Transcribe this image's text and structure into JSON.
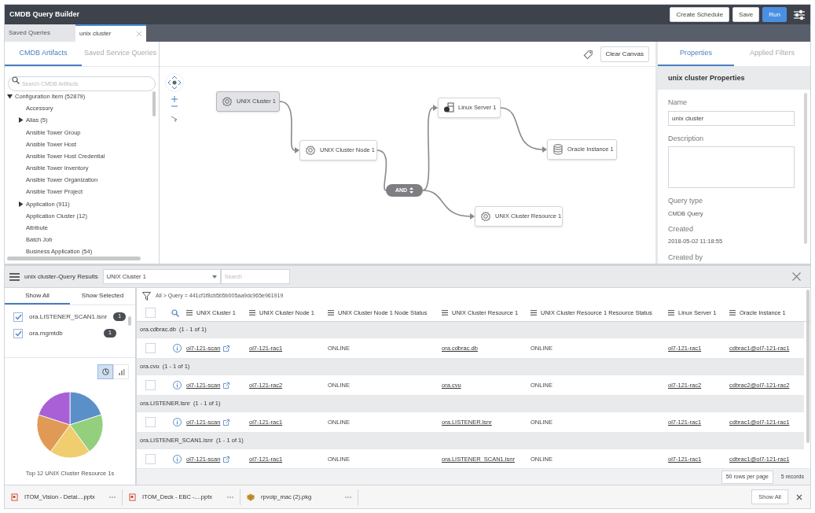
{
  "window": {
    "title": "CMDB Query Builder"
  },
  "header_buttons": [
    {
      "label": "Create Schedule",
      "kind": "default"
    },
    {
      "label": "Save",
      "kind": "default"
    },
    {
      "label": "Run",
      "kind": "primary"
    }
  ],
  "doc_tabs": [
    {
      "label": "Saved Queries",
      "selected": false,
      "closable": false
    },
    {
      "label": "unix cluster",
      "selected": true,
      "closable": true
    }
  ],
  "artifacts_panel": {
    "tabs": [
      {
        "label": "CMDB Artifacts",
        "selected": true
      },
      {
        "label": "Saved Service Queries",
        "selected": false
      }
    ],
    "search": {
      "placeholder": "Search CMDB Artifacts"
    },
    "tree": [
      {
        "label": "Configuration Item (52879)",
        "expanded": true,
        "children": [
          {
            "label": "Accessory"
          },
          {
            "label": "Alias (5)",
            "expanded": false
          },
          {
            "label": "Ansible Tower Group"
          },
          {
            "label": "Ansible Tower Host"
          },
          {
            "label": "Ansible Tower Host Credential"
          },
          {
            "label": "Ansible Tower Inventory"
          },
          {
            "label": "Ansible Tower Organization"
          },
          {
            "label": "Ansible Tower Project"
          },
          {
            "label": "Application (911)",
            "expanded": false
          },
          {
            "label": "Application Cluster (12)"
          },
          {
            "label": "Attribute"
          },
          {
            "label": "Batch Job"
          },
          {
            "label": "Business Application (54)"
          }
        ]
      }
    ]
  },
  "canvas": {
    "clear_button": "Clear Canvas",
    "nodes": [
      {
        "label": "UNIX Cluster 1",
        "kind": "gear",
        "selected": true
      },
      {
        "label": "UNIX Cluster Node 1",
        "kind": "gear",
        "selected": false
      },
      {
        "label": "Linux Server 1",
        "kind": "server",
        "selected": false
      },
      {
        "label": "Oracle Instance 1",
        "kind": "database",
        "selected": false
      },
      {
        "label": "UNIX Cluster Resource 1",
        "kind": "gear",
        "selected": false
      }
    ],
    "operator": {
      "label": "AND"
    }
  },
  "properties_panel": {
    "tabs": [
      {
        "label": "Properties",
        "selected": true
      },
      {
        "label": "Applied Filters",
        "selected": false
      }
    ],
    "heading": "unix cluster Properties",
    "fields": [
      {
        "label": "Name",
        "kind": "input",
        "value": "unix cluster"
      },
      {
        "label": "Description",
        "kind": "textarea"
      },
      {
        "label": "Query type",
        "kind": "text",
        "value": "CMDB Query"
      },
      {
        "label": "Created",
        "kind": "text",
        "value": "2018-05-02 11:18:55"
      },
      {
        "label": "Created by",
        "kind": "text"
      }
    ]
  },
  "results": {
    "title": "unix cluster-Query Results",
    "class_select": "UNIX Cluster 1",
    "search": {
      "placeholder": "Search"
    },
    "filter_tabs": [
      {
        "label": "Show All",
        "selected": true
      },
      {
        "label": "Show Selected",
        "selected": false
      }
    ],
    "filter_items": [
      {
        "label": "ora.LISTENER_SCAN1.lsnr",
        "count": "1",
        "checked": true
      },
      {
        "label": "ora.mgmtdb",
        "count": "1",
        "checked": true
      }
    ],
    "chart_modes": [
      {
        "kind": "pie",
        "selected": true
      },
      {
        "kind": "bar",
        "selected": false
      }
    ],
    "chart_caption": "Top 12 UNIX Cluster Resource 1s",
    "breadcrumb": "All > Query = 441cf1f8cb5b5b005aa9dc965e961919",
    "select_all": {
      "checked": false
    },
    "columns": [
      {
        "label": "UNIX Cluster 1",
        "link": true,
        "external": true
      },
      {
        "label": "UNIX Cluster Node 1",
        "link": true,
        "external": false
      },
      {
        "label": "UNIX Cluster Node 1 Node Status",
        "link": false,
        "external": false
      },
      {
        "label": "UNIX Cluster Resource 1",
        "link": true,
        "external": false
      },
      {
        "label": "UNIX Cluster Resource 1 Resource Status",
        "link": false,
        "external": false
      },
      {
        "label": "Linux Server 1",
        "link": true,
        "external": false
      },
      {
        "label": "Oracle Instance 1",
        "link": true,
        "external": false
      }
    ],
    "groups": [
      {
        "label": "ora.cdbrac.db  (1 - 1 of 1)",
        "rows": [
          {
            "checked": false,
            "cells": [
              "ol7-121-scan",
              "ol7-121-rac1",
              "ONLINE",
              "ora.cdbrac.db",
              "ONLINE",
              "ol7-121-rac1",
              "cdbrac1@ol7-121-rac1"
            ]
          }
        ]
      },
      {
        "label": "ora.cvu  (1 - 1 of 1)",
        "rows": [
          {
            "checked": false,
            "cells": [
              "ol7-121-scan",
              "ol7-121-rac2",
              "ONLINE",
              "ora.cvu",
              "ONLINE",
              "ol7-121-rac2",
              "cdbrac2@ol7-121-rac2"
            ]
          }
        ]
      },
      {
        "label": "ora.LISTENER.lsnr  (1 - 1 of 1)",
        "rows": [
          {
            "checked": false,
            "cells": [
              "ol7-121-scan",
              "ol7-121-rac1",
              "ONLINE",
              "ora.LISTENER.lsnr",
              "ONLINE",
              "ol7-121-rac1",
              "cdbrac1@ol7-121-rac1"
            ]
          }
        ]
      },
      {
        "label": "ora.LISTENER_SCAN1.lsnr  (1 - 1 of 1)",
        "rows": [
          {
            "checked": false,
            "cells": [
              "ol7-121-scan",
              "ol7-121-rac1",
              "ONLINE",
              "ora.LISTENER_SCAN1.lsnr",
              "ONLINE",
              "ol7-121-rac1",
              "cdbrac1@ol7-121-rac1"
            ]
          }
        ]
      }
    ],
    "page_size": "50 rows per page",
    "record_count": "5 records"
  },
  "downloads": {
    "items": [
      {
        "name": "ITOM_Vision - Detai....pptx",
        "kind": "document"
      },
      {
        "name": "ITOM_Deck - EBC -....pptx",
        "kind": "document"
      },
      {
        "name": "rpvoip_mac (2).pkg",
        "kind": "package"
      }
    ],
    "show_all": "Show All"
  }
}
